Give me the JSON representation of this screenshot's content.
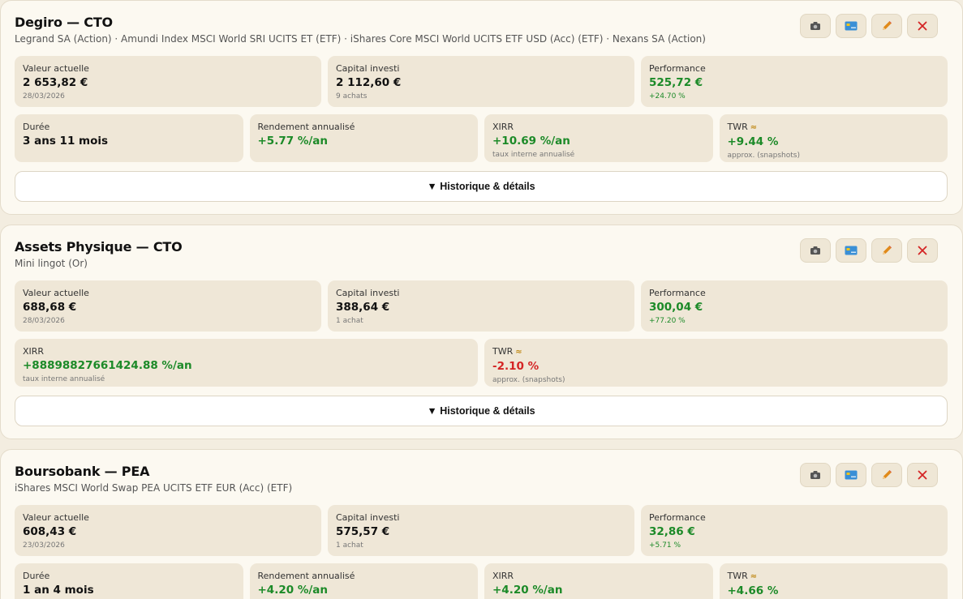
{
  "labels": {
    "current_value": "Valeur actuelle",
    "invested": "Capital investi",
    "performance": "Performance",
    "duration": "Durée",
    "annualized": "Rendement annualisé",
    "xirr": "XIRR",
    "xirr_note": "taux interne annualisé",
    "twr": "TWR",
    "twr_approx": "≈",
    "twr_note": "approx. (snapshots)",
    "history_button": "▼ Historique & détails"
  },
  "action_icons": [
    "camera-icon",
    "card-icon",
    "pencil-icon",
    "close-icon"
  ],
  "colors": {
    "positive": "#1c8a28",
    "negative": "#d42424",
    "delete": "#d42424",
    "edit": "#e08a1a"
  },
  "accounts": [
    {
      "title": "Degiro — CTO",
      "holdings": "Legrand SA (Action) · Amundi Index MSCI World SRI UCITS ET (ETF) · iShares Core MSCI World UCITS ETF USD (Acc) (ETF) · Nexans SA (Action)",
      "current_value": "2 653,82 €",
      "value_date": "28/03/2026",
      "invested": "2 112,60 €",
      "purchases": "9 achats",
      "performance": "525,72 €",
      "performance_pct": "+24.70 %",
      "duration": "3 ans 11 mois",
      "annualized": "+5.77 %/an",
      "xirr": "+10.69 %/an",
      "twr": "+9.44 %"
    },
    {
      "title": "Assets Physique — CTO",
      "holdings": "Mini lingot (Or)",
      "current_value": "688,68 €",
      "value_date": "28/03/2026",
      "invested": "388,64 €",
      "purchases": "1 achat",
      "performance": "300,04 €",
      "performance_pct": "+77.20 %",
      "xirr": "+88898827661424.88 %/an",
      "twr": "-2.10 %"
    },
    {
      "title": "Boursobank — PEA",
      "holdings": "iShares MSCI World Swap PEA UCITS ETF EUR (Acc) (ETF)",
      "current_value": "608,43 €",
      "value_date": "23/03/2026",
      "invested": "575,57 €",
      "purchases": "1 achat",
      "performance": "32,86 €",
      "performance_pct": "+5.71 %",
      "duration": "1 an 4 mois",
      "annualized": "+4.20 %/an",
      "xirr": "+4.20 %/an",
      "twr": "+4.66 %"
    }
  ]
}
